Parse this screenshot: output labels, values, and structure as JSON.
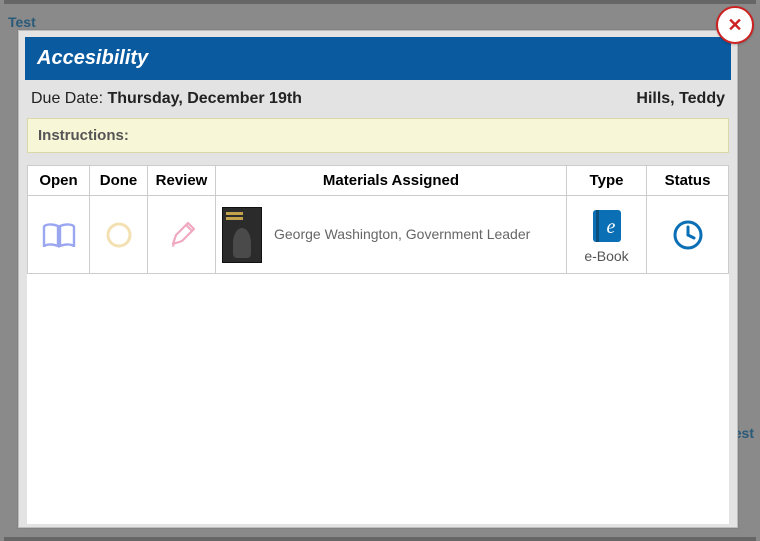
{
  "modal": {
    "title": "Accesibility",
    "dueLabel": "Due Date:",
    "dueDate": "Thursday, December 19th",
    "studentName": "Hills, Teddy",
    "instructionsLabel": "Instructions:"
  },
  "columns": {
    "open": "Open",
    "done": "Done",
    "review": "Review",
    "materials": "Materials Assigned",
    "type": "Type",
    "status": "Status"
  },
  "rows": [
    {
      "materialTitle": "George Washington, Government Leader",
      "typeLabel": "e-Book"
    }
  ],
  "icons": {
    "open": "book-open-icon",
    "done": "circle-progress-icon",
    "review": "pencil-icon",
    "type": "ebook-icon",
    "status": "clock-icon",
    "close": "close-icon"
  },
  "backgroundHints": {
    "topLeft": "Test",
    "right": "Test"
  },
  "closeGlyph": "✕"
}
